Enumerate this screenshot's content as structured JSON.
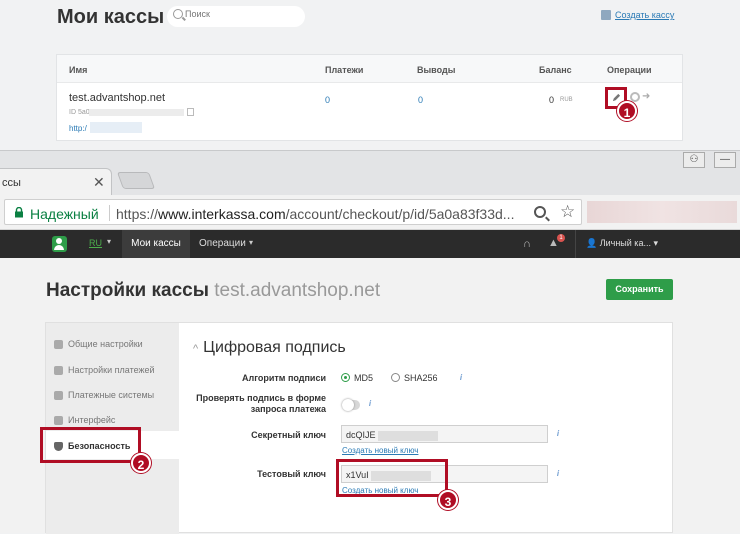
{
  "top": {
    "title": "Мои кассы",
    "search_placeholder": "Поиск",
    "create_link": "Создать кассу",
    "columns": {
      "name": "Имя",
      "payments": "Платежи",
      "withdrawals": "Выводы",
      "balance": "Баланс",
      "operations": "Операции"
    },
    "row": {
      "name": "test.advantshop.net",
      "id": "ID 5a0a6",
      "url": "http:/",
      "payments": "0",
      "withdrawals": "0",
      "balance": "0",
      "currency": "RUB"
    },
    "badge1": "1"
  },
  "browser": {
    "tab_title": "ссы",
    "tab_close": "✕",
    "secure_label": "Надежный",
    "url_scheme": "https://",
    "url_host": "www.interkassa.com",
    "url_path": "/account/checkout/p/id/5a0a83f33d..."
  },
  "nav": {
    "lang": "RU",
    "active": "Мои кассы",
    "operations": "Операции",
    "alert_count": "1",
    "account": "Личный ка..."
  },
  "settings": {
    "title": "Настройки кассы",
    "subtitle": "test.advantshop.net",
    "save": "Сохранить",
    "sidebar": [
      {
        "label": "Общие настройки"
      },
      {
        "label": "Настройки платежей"
      },
      {
        "label": "Платежные системы"
      },
      {
        "label": "Интерфейс"
      },
      {
        "label": "Безопасность"
      }
    ],
    "section_title": "Цифровая подпись",
    "algorithm_label": "Алгоритм подписи",
    "algo_md5": "MD5",
    "algo_sha": "SHA256",
    "verify_label_1": "Проверять подпись в форме",
    "verify_label_2": "запроса платежа",
    "secret_label": "Секретный ключ",
    "secret_value": "dcQIJE",
    "secret_link": "Создать новый ключ",
    "test_label": "Тестовый ключ",
    "test_value": "x1VuI",
    "test_link": "Создать новый ключ",
    "badge2": "2",
    "badge3": "3"
  },
  "colors": {
    "accent_red": "#b00d24",
    "green": "#2e9d49",
    "link": "#2a7ab5"
  }
}
